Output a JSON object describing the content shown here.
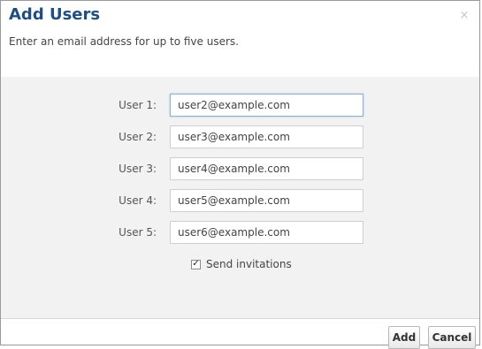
{
  "dialog": {
    "title": "Add Users",
    "subtitle": "Enter an email address for up to five users.",
    "close_glyph": "×"
  },
  "users": [
    {
      "label": "User 1:",
      "value": "user2@example.com"
    },
    {
      "label": "User 2:",
      "value": "user3@example.com"
    },
    {
      "label": "User 3:",
      "value": "user4@example.com"
    },
    {
      "label": "User 4:",
      "value": "user5@example.com"
    },
    {
      "label": "User 5:",
      "value": "user6@example.com"
    }
  ],
  "send_invitations": {
    "label": "Send invitations",
    "checked": true,
    "check_glyph": "✓"
  },
  "footer": {
    "add_label": "Add",
    "cancel_label": "Cancel"
  },
  "colors": {
    "title": "#1d4f86",
    "body_background": "#f2f2f2",
    "focus_border": "#8bb3dc"
  }
}
